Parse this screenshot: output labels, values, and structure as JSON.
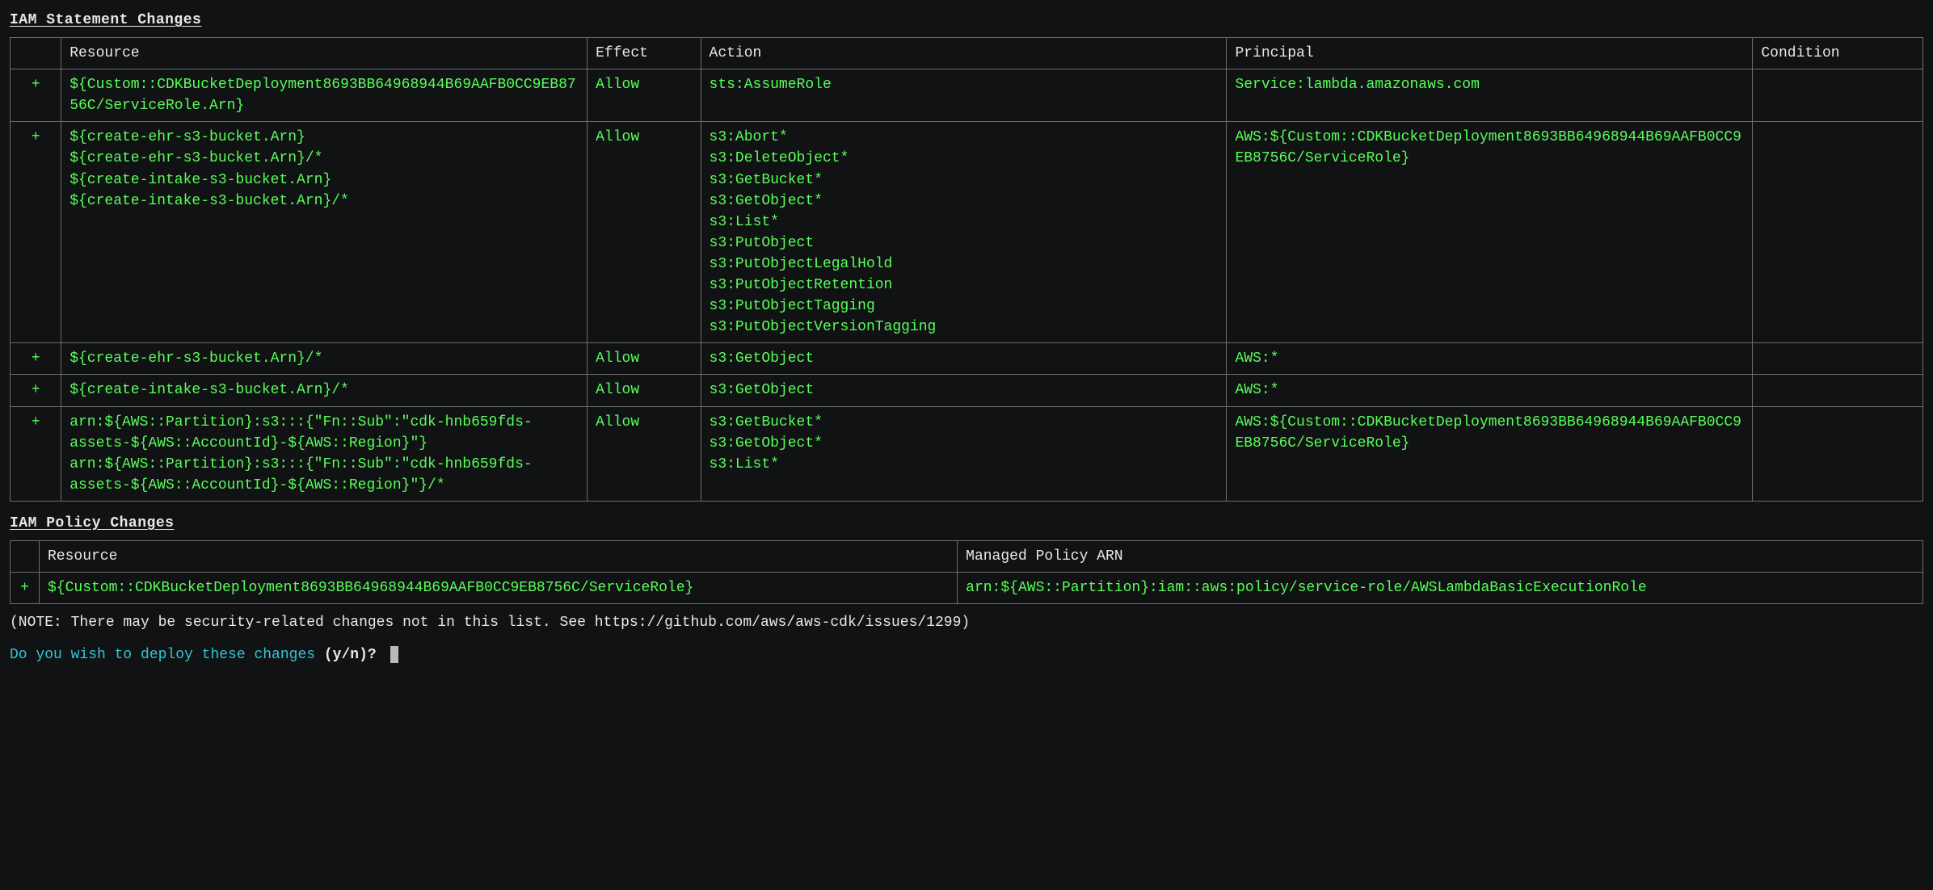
{
  "sections": {
    "iam_statement_title": "IAM Statement Changes",
    "iam_policy_title": "IAM Policy Changes"
  },
  "statement_table": {
    "headers": {
      "mark": "",
      "resource": "Resource",
      "effect": "Effect",
      "action": "Action",
      "principal": "Principal",
      "condition": "Condition"
    },
    "rows": [
      {
        "mark": "+",
        "resource": "${Custom::CDKBucketDeployment8693BB64968944B69AAFB0CC9EB8756C/ServiceRole.Arn}",
        "effect": "Allow",
        "action": "sts:AssumeRole",
        "principal": "Service:lambda.amazonaws.com",
        "condition": ""
      },
      {
        "mark": "+",
        "resource": "${create-ehr-s3-bucket.Arn}\n${create-ehr-s3-bucket.Arn}/*\n${create-intake-s3-bucket.Arn}\n${create-intake-s3-bucket.Arn}/*",
        "effect": "Allow",
        "action": "s3:Abort*\ns3:DeleteObject*\ns3:GetBucket*\ns3:GetObject*\ns3:List*\ns3:PutObject\ns3:PutObjectLegalHold\ns3:PutObjectRetention\ns3:PutObjectTagging\ns3:PutObjectVersionTagging",
        "principal": "AWS:${Custom::CDKBucketDeployment8693BB64968944B69AAFB0CC9EB8756C/ServiceRole}",
        "condition": ""
      },
      {
        "mark": "+",
        "resource": "${create-ehr-s3-bucket.Arn}/*",
        "effect": "Allow",
        "action": "s3:GetObject",
        "principal": "AWS:*",
        "condition": ""
      },
      {
        "mark": "+",
        "resource": "${create-intake-s3-bucket.Arn}/*",
        "effect": "Allow",
        "action": "s3:GetObject",
        "principal": "AWS:*",
        "condition": ""
      },
      {
        "mark": "+",
        "resource": "arn:${AWS::Partition}:s3:::{\"Fn::Sub\":\"cdk-hnb659fds-assets-${AWS::AccountId}-${AWS::Region}\"}\narn:${AWS::Partition}:s3:::{\"Fn::Sub\":\"cdk-hnb659fds-assets-${AWS::AccountId}-${AWS::Region}\"}/*",
        "effect": "Allow",
        "action": "s3:GetBucket*\ns3:GetObject*\ns3:List*",
        "principal": "AWS:${Custom::CDKBucketDeployment8693BB64968944B69AAFB0CC9EB8756C/ServiceRole}",
        "condition": ""
      }
    ]
  },
  "policy_table": {
    "headers": {
      "mark": "",
      "resource": "Resource",
      "arn": "Managed Policy ARN"
    },
    "rows": [
      {
        "mark": "+",
        "resource": "${Custom::CDKBucketDeployment8693BB64968944B69AAFB0CC9EB8756C/ServiceRole}",
        "arn": "arn:${AWS::Partition}:iam::aws:policy/service-role/AWSLambdaBasicExecutionRole"
      }
    ]
  },
  "note": "(NOTE: There may be security-related changes not in this list. See https://github.com/aws/aws-cdk/issues/1299)",
  "prompt": {
    "question": "Do you wish to deploy these changes ",
    "yn": "(y/n)? "
  }
}
